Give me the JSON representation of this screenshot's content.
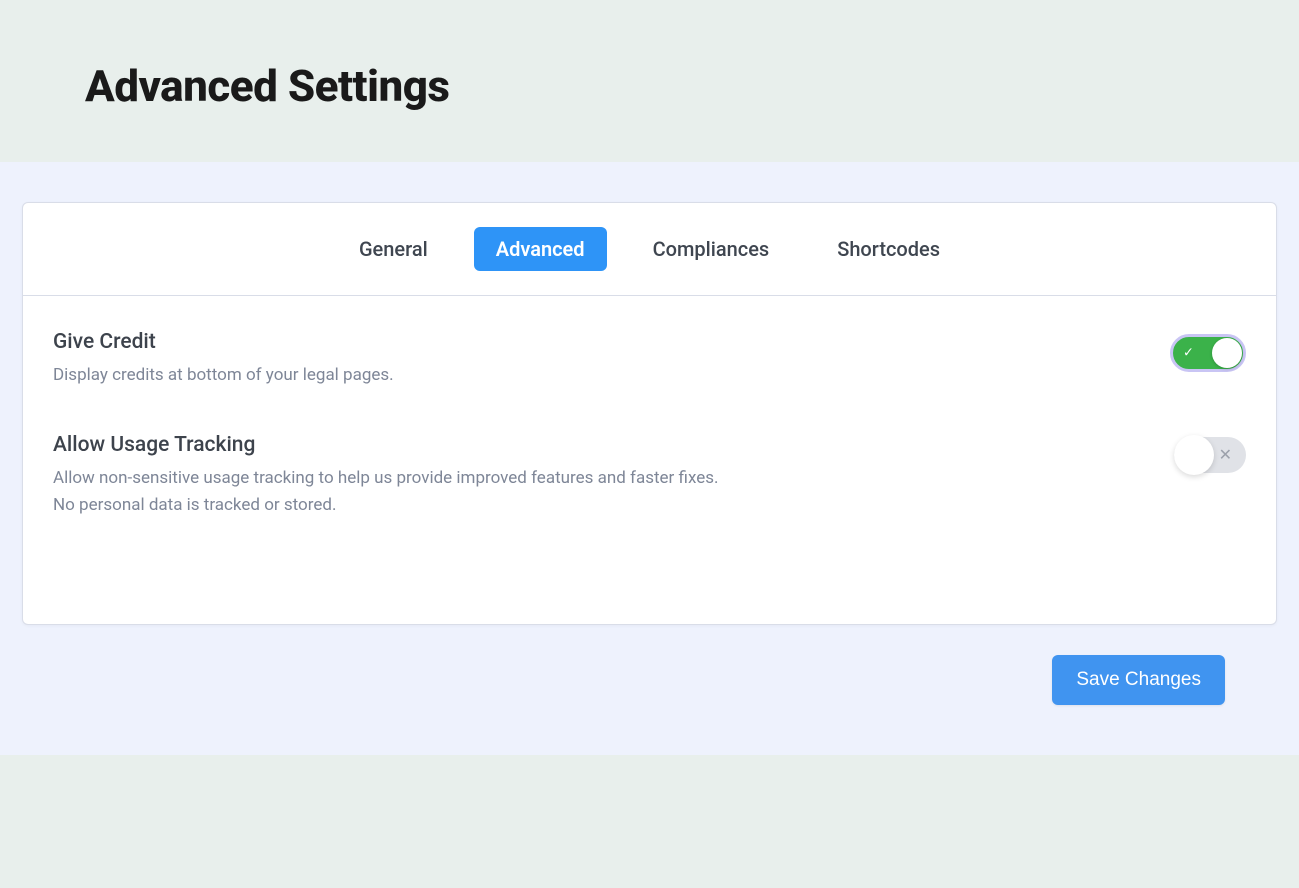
{
  "header": {
    "title": "Advanced Settings"
  },
  "tabs": [
    {
      "id": "general",
      "label": "General",
      "active": false
    },
    {
      "id": "advanced",
      "label": "Advanced",
      "active": true
    },
    {
      "id": "compliances",
      "label": "Compliances",
      "active": false
    },
    {
      "id": "shortcodes",
      "label": "Shortcodes",
      "active": false
    }
  ],
  "settings": [
    {
      "id": "give-credit",
      "title": "Give Credit",
      "description": "Display credits at bottom of your legal pages.",
      "enabled": true
    },
    {
      "id": "allow-usage-tracking",
      "title": "Allow Usage Tracking",
      "description": "Allow non-sensitive usage tracking to help us provide improved features and faster fixes. No personal data is tracked or stored.",
      "enabled": false
    }
  ],
  "actions": {
    "save_label": "Save Changes"
  }
}
